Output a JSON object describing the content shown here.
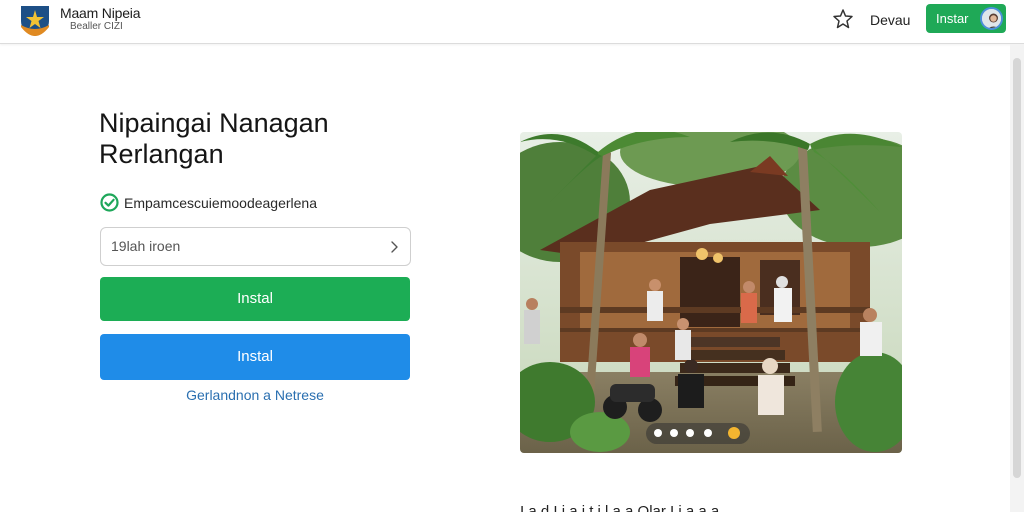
{
  "header": {
    "brand_name": "Maam Nipeia",
    "brand_sub": "Bealler CIZI",
    "nav_link": "Devau",
    "install_label": "Instar",
    "logo_icon": "shield-star-logo",
    "star_icon": "star-outline-icon",
    "avatar_icon": "user-avatar-icon"
  },
  "main": {
    "title_line1": "Nipaingai Nanagan",
    "title_line2": "Rerlangan",
    "status_text": "Empamcescuiemoodeagerlena",
    "status_icon": "check-circle-icon",
    "search_placeholder": "19lah iroen",
    "search_icon": "chevron-right-icon",
    "button_primary": "Instal",
    "button_secondary": "Instal",
    "link_text": "Gerlandnon a Netrese"
  },
  "carousel": {
    "image_alt": "traditional wooden house with palm trees and people",
    "dots": [
      "1",
      "2",
      "3",
      "4",
      "5"
    ],
    "active_index": 4
  },
  "footer": {
    "cutoff_text": "I a d I i a i t i l a a Olar I i a a a"
  },
  "colors": {
    "green": "#1cad55",
    "blue": "#1f8ce8",
    "link": "#2a6fb0",
    "active_dot": "#f3b530"
  }
}
